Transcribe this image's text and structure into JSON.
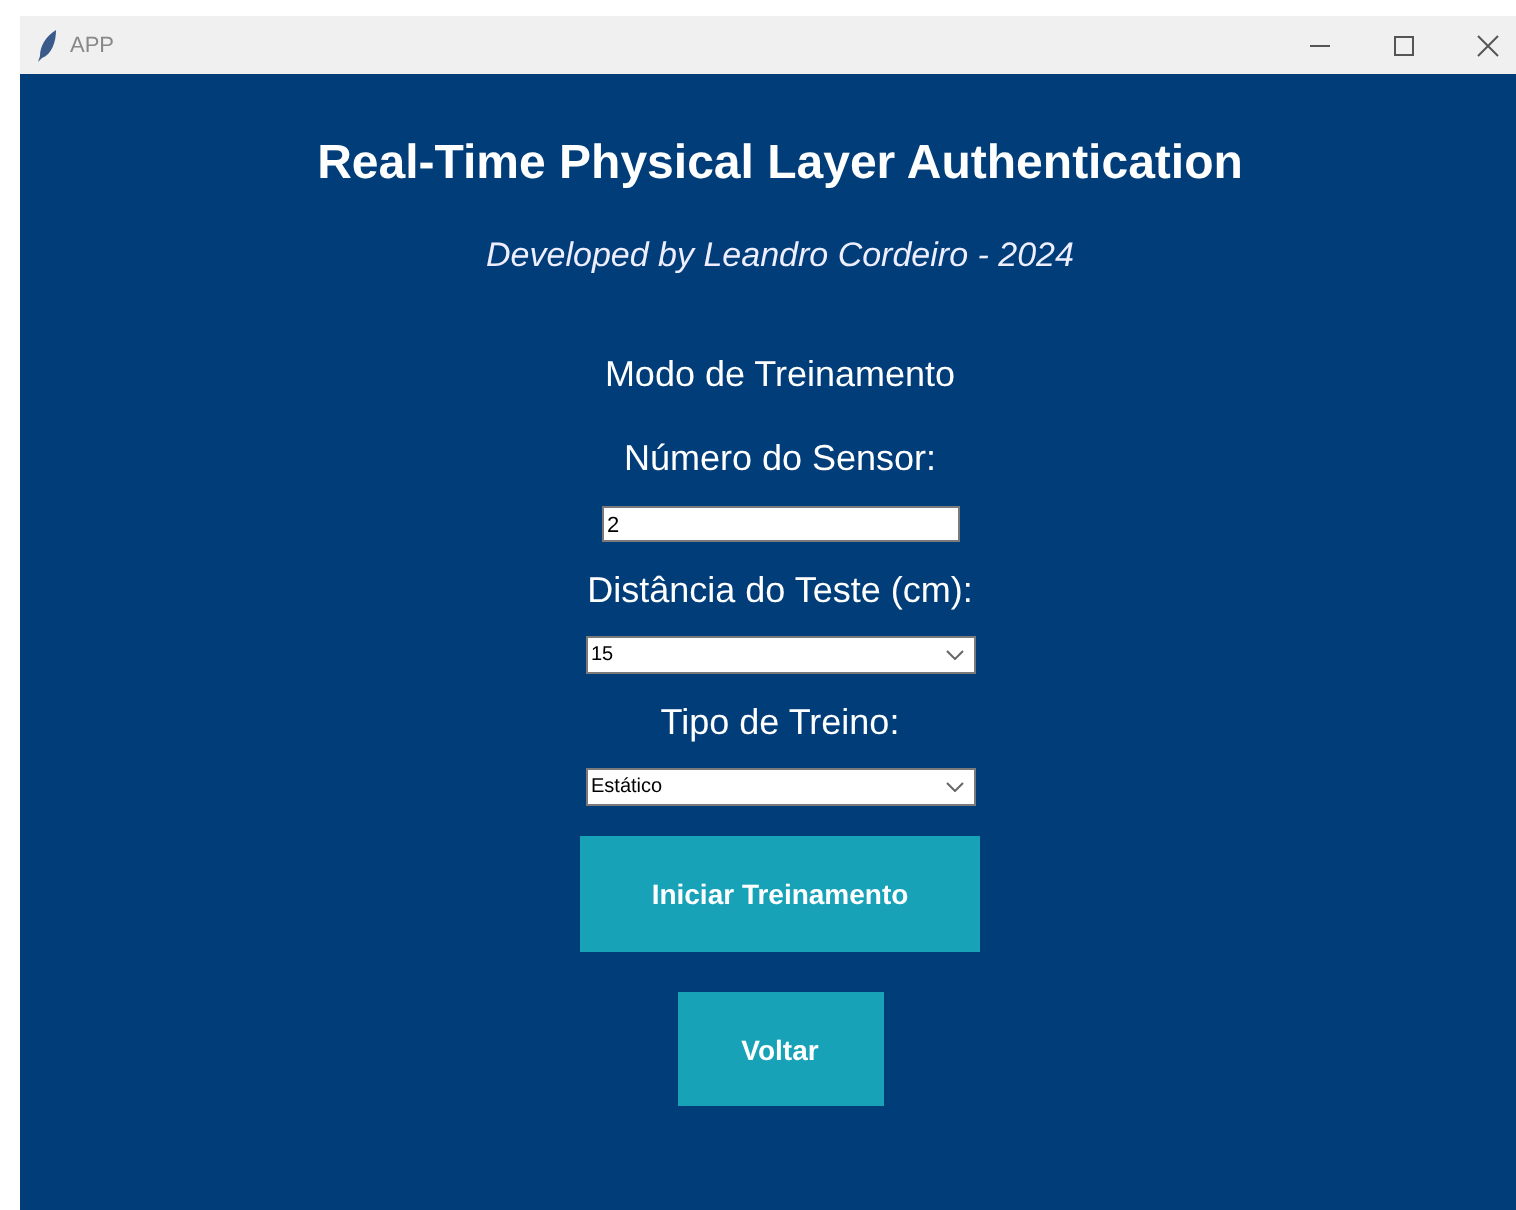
{
  "window": {
    "title": "APP"
  },
  "heading": "Real-Time Physical Layer Authentication",
  "subtitle": "Developed by Leandro Cordeiro - 2024",
  "section": "Modo de Treinamento",
  "fields": [
    {
      "kind": "entry",
      "label": "Número do Sensor:",
      "value": "2"
    },
    {
      "kind": "combo",
      "label": "Distância do Teste (cm):",
      "value": "15"
    },
    {
      "kind": "combo",
      "label": "Tipo de Treino:",
      "value": "Estático"
    }
  ],
  "buttons": [
    {
      "label": "Iniciar Treinamento",
      "kind": "wide"
    },
    {
      "label": "Voltar",
      "kind": "narrow"
    }
  ]
}
